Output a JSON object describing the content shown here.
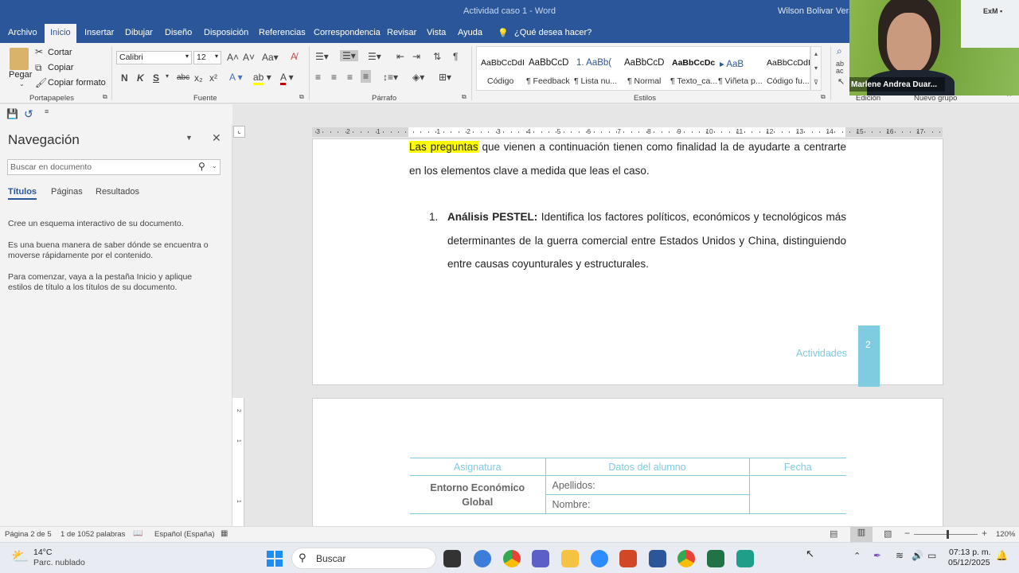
{
  "window": {
    "title": "Actividad caso 1  -  Word",
    "user": "Wilson Bolivar Vera"
  },
  "tabs": [
    "Archivo",
    "Inicio",
    "Insertar",
    "Dibujar",
    "Diseño",
    "Disposición",
    "Referencias",
    "Correspondencia",
    "Revisar",
    "Vista",
    "Ayuda"
  ],
  "tell_me": "¿Qué desea hacer?",
  "clipboard": {
    "paste": "Pegar",
    "cut": "Cortar",
    "copy": "Copiar",
    "format_painter": "Copiar formato",
    "group": "Portapapeles"
  },
  "font": {
    "name": "Calibri",
    "size": "12",
    "group": "Fuente",
    "bold": "N",
    "italic": "K",
    "underline": "S",
    "strike": "abc"
  },
  "paragraph": {
    "group": "Párrafo"
  },
  "styles": {
    "group": "Estilos",
    "items": [
      {
        "preview": "AaBbCcDdI",
        "name": "Código"
      },
      {
        "preview": "AaBbCcD",
        "name": "¶ Feedback"
      },
      {
        "preview": "1.  AaBb(",
        "name": "¶ Lista nu..."
      },
      {
        "preview": "AaBbCcD",
        "name": "¶ Normal"
      },
      {
        "preview": "AaBbCcDc",
        "name": "¶ Texto_ca..."
      },
      {
        "preview": "▸     AaB",
        "name": "¶ Viñeta p..."
      },
      {
        "preview": "AaBbCcDdI",
        "name": "Código fu..."
      }
    ]
  },
  "editing": {
    "group": "Edición"
  },
  "new_group": "Nuevo grupo",
  "webcam": {
    "name": "Marlene Andrea Duar..."
  },
  "nav": {
    "title": "Navegación",
    "search_placeholder": "Buscar en documento",
    "tabs": [
      "Títulos",
      "Páginas",
      "Resultados"
    ],
    "p1": "Cree un esquema interactivo de su documento.",
    "p2": "Es una buena manera de saber dónde se encuentra o moverse rápidamente por el contenido.",
    "p3": "Para comenzar, vaya a la pestaña Inicio y aplique estilos de título a los títulos de su documento."
  },
  "doc": {
    "highlight": "Las preguntas",
    "intro_rest": " que vienen a continuación tienen como finalidad la de ayudarte a centrarte en los elementos clave a medida que leas el caso.",
    "item_num": "1.",
    "item_bold": "Análisis PESTEL:",
    "item_text": " Identifica los factores políticos, económicos y tecnológicos más determinantes de la guerra comercial entre Estados Unidos y China, distinguiendo entre causas coyunturales y estructurales.",
    "footer_label": "Actividades",
    "page_num": "2",
    "table": {
      "h1": "Asignatura",
      "h2": "Datos del alumno",
      "h3": "Fecha",
      "subject": "Entorno Económico Global",
      "surname": "Apellidos:",
      "name": "Nombre:"
    }
  },
  "ruler_numbers": [
    "3",
    "2",
    "1",
    "1",
    "2",
    "3",
    "4",
    "5",
    "6",
    "7",
    "8",
    "9",
    "10",
    "11",
    "12",
    "13",
    "14",
    "15",
    "16",
    "17"
  ],
  "status": {
    "page": "Página 2 de 5",
    "words": "1 de 1052 palabras",
    "lang": "Español (España)",
    "zoom": "120%"
  },
  "taskbar": {
    "temp": "14°C",
    "weather": "Parc. nublado",
    "search": "Buscar",
    "time": "07:13 p. m.",
    "date": "05/12/2025"
  }
}
